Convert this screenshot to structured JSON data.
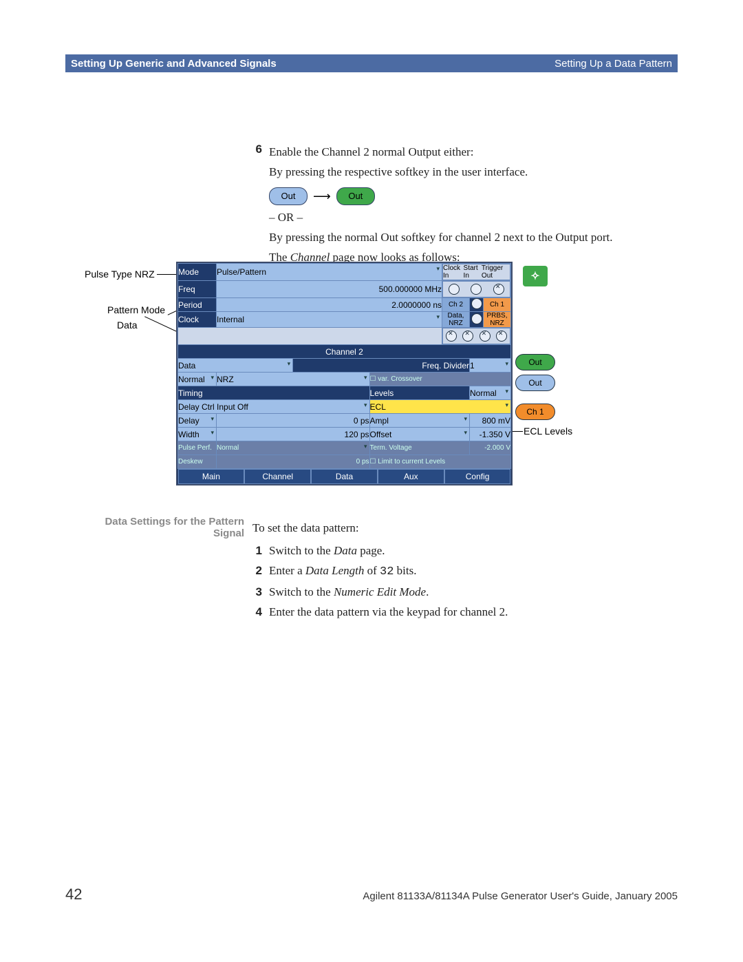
{
  "header": {
    "left": "Setting Up Generic and Advanced Signals",
    "right": "Setting Up a Data Pattern"
  },
  "step6": {
    "num": "6",
    "l1": "Enable the Channel 2 normal Output either:",
    "l2": "By pressing the respective softkey in the user interface.",
    "out_off": "Out",
    "out_on": "Out",
    "or": "– OR –",
    "l3": "By pressing the normal Out softkey for channel 2 next to the Output port.",
    "l4a": "The ",
    "l4b": "Channel",
    "l4c": " page now looks as follows:"
  },
  "callouts": {
    "pulse_type": "Pulse Type NRZ",
    "pattern_mode": "Pattern Mode",
    "data": "Data",
    "ecl": "ECL Levels"
  },
  "ui": {
    "top_io": {
      "clockin": "Clock In",
      "startin": "Start In",
      "triggerout": "Trigger Out"
    },
    "mode_lbl": "Mode",
    "mode_val": "Pulse/Pattern",
    "freq_lbl": "Freq",
    "freq_val": "500.000000 MHz",
    "period_lbl": "Period",
    "period_val": "2.0000000 ns",
    "clock_lbl": "Clock",
    "clock_val": "Internal",
    "ch2": "Ch 2",
    "ch1": "Ch 1",
    "data_nrz": "Data, NRZ",
    "prbs_nrz": "PRBS, NRZ",
    "section": "Channel 2",
    "data_lbl": "Data",
    "freqdiv_lbl": "Freq. Divider",
    "freqdiv_val": "1",
    "normal_lbl": "Normal",
    "nrz": "NRZ",
    "varx": "var. Crossover",
    "timing_lbl": "Timing",
    "levels_lbl": "Levels",
    "normal2": "Normal",
    "dci_lbl": "Delay Ctrl Input Off",
    "ecl": "ECL",
    "delay_lbl": "Delay",
    "delay_val": "0 ps",
    "ampl_lbl": "Ampl",
    "ampl_val": "800 mV",
    "width_lbl": "Width",
    "width_val": "120 ps",
    "offset_lbl": "Offset",
    "offset_val": "-1.350 V",
    "pp_lbl": "Pulse Perf.",
    "pp_val": "Normal",
    "tv_lbl": "Term. Voltage",
    "tv_val": "-2.000 V",
    "deskew_lbl": "Deskew",
    "deskew_val": "0 ps",
    "limit": "Limit to current Levels",
    "tabs": [
      "Main",
      "Channel",
      "Data",
      "Aux",
      "Config"
    ],
    "side": {
      "out": "Out",
      "out_bar": "Out",
      "ch1": "Ch 1"
    }
  },
  "sideheading": "Data Settings for the Pattern Signal",
  "steps2": {
    "intro": "To set the data pattern:",
    "s1a": "Switch to the ",
    "s1b": "Data",
    "s1c": " page.",
    "s2a": "Enter a ",
    "s2b": "Data Length",
    "s2c": " of ",
    "s2d": "32",
    "s2e": " bits.",
    "s3a": "Switch to the ",
    "s3b": "Numeric Edit Mode",
    "s3c": ".",
    "s4": "Enter the data pattern via the keypad for channel 2."
  },
  "footer": {
    "page": "42",
    "book": "Agilent 81133A/81134A Pulse Generator User's Guide, January 2005"
  }
}
